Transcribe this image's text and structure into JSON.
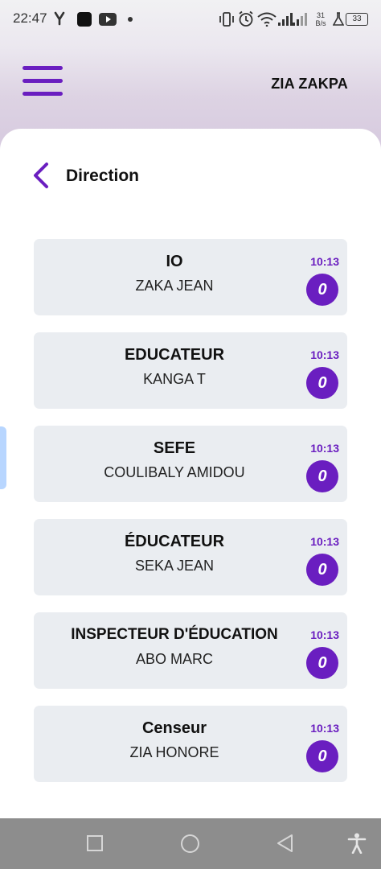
{
  "status_bar": {
    "time": "22:47",
    "network_speed_value": "31",
    "network_speed_unit": "B/s",
    "battery": "33"
  },
  "header": {
    "user_name": "ZIA ZAKPA"
  },
  "page": {
    "title": "Direction"
  },
  "contacts": [
    {
      "role": "IO",
      "name": "ZAKA JEAN",
      "time": "10:13",
      "unread": "0"
    },
    {
      "role": "EDUCATEUR",
      "name": "KANGA T",
      "time": "10:13",
      "unread": "0"
    },
    {
      "role": "SEFE",
      "name": "COULIBALY AMIDOU",
      "time": "10:13",
      "unread": "0"
    },
    {
      "role": "ÉDUCATEUR",
      "name": "SEKA JEAN",
      "time": "10:13",
      "unread": "0"
    },
    {
      "role": "INSPECTEUR D'ÉDUCATION",
      "name": "ABO MARC",
      "time": "10:13",
      "unread": "0"
    },
    {
      "role": "Censeur",
      "name": "ZIA HONORE",
      "time": "10:13",
      "unread": "0"
    }
  ],
  "colors": {
    "accent": "#6a1ec0",
    "card_background": "#eaedf1",
    "nav_bar": "#8d8d8d"
  },
  "icons": {
    "menu": "hamburger-menu-icon",
    "back": "chevron-left-icon",
    "nav_recents": "square-icon",
    "nav_home": "circle-icon",
    "nav_back": "triangle-back-icon",
    "nav_accessibility": "accessibility-icon"
  }
}
